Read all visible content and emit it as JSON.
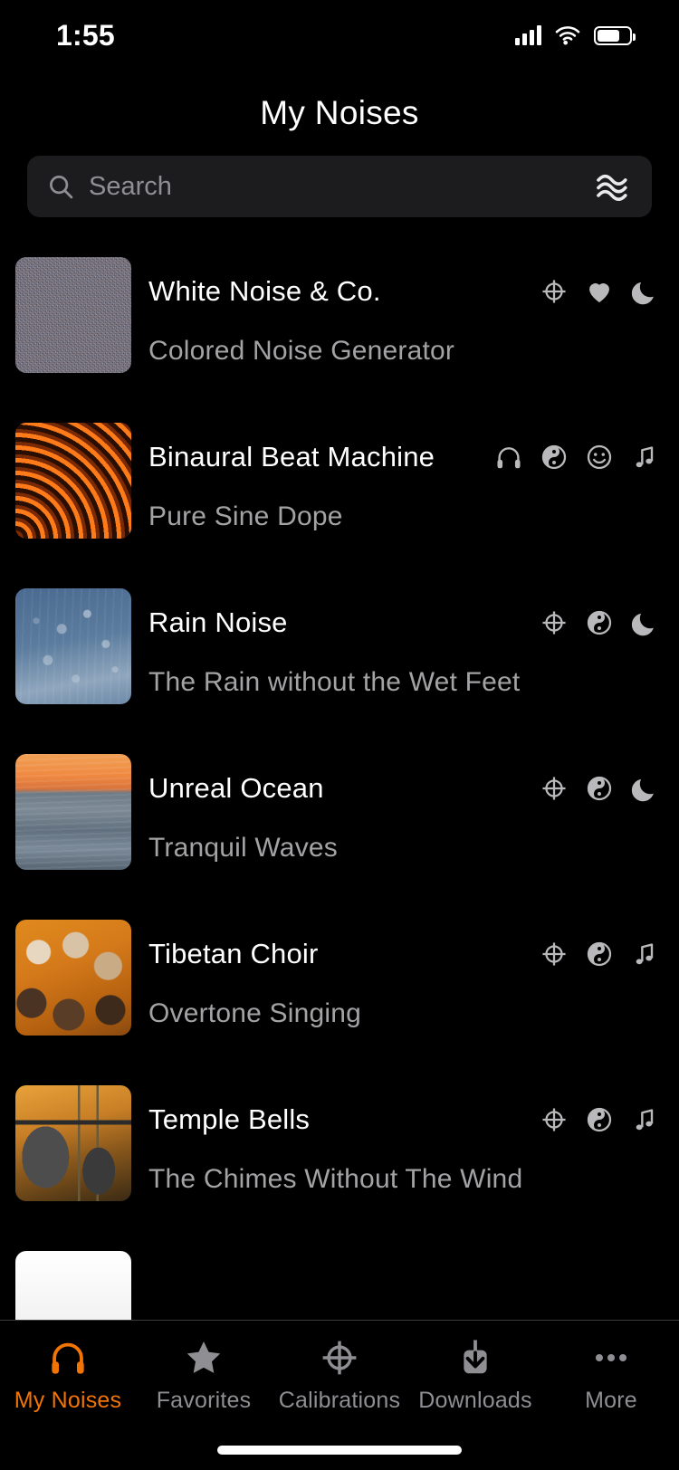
{
  "status_bar": {
    "time": "1:55",
    "cellular_icon": "signal-bars-icon",
    "wifi_icon": "wifi-icon",
    "battery_icon": "battery-icon"
  },
  "header": {
    "title": "My Noises"
  },
  "search": {
    "placeholder": "Search",
    "value": "",
    "search_icon": "search-icon",
    "filter_icon": "waves-icon"
  },
  "colors": {
    "accent": "#f27405",
    "background": "#000000",
    "search_field": "#1c1c1e",
    "primary_text": "#ffffff",
    "secondary_text": "#a3a3a6",
    "inactive_tab": "#8e8e93",
    "row_icon": "#b9b9bc",
    "separator": "#3a3a3c"
  },
  "list": {
    "rows": [
      {
        "title": "White Noise & Co.",
        "subtitle": "Colored Noise Generator",
        "artwork": "static-noise-thumbnail",
        "art_class": "art-noise",
        "icons": [
          "calibration-icon",
          "favorite-icon",
          "sleep-timer-icon"
        ]
      },
      {
        "title": "Binaural Beat Machine",
        "subtitle": "Pure Sine Dope",
        "artwork": "concentric-orange-arcs-thumbnail",
        "art_class": "art-binaural",
        "icons": [
          "headphones-icon",
          "yin-yang-icon",
          "smiley-icon",
          "music-note-icon"
        ]
      },
      {
        "title": "Rain Noise",
        "subtitle": "The Rain without the Wet Feet",
        "artwork": "raindrops-on-window-thumbnail",
        "art_class": "art-rain",
        "icons": [
          "calibration-icon",
          "yin-yang-icon",
          "sleep-timer-icon"
        ]
      },
      {
        "title": "Unreal Ocean",
        "subtitle": "Tranquil Waves",
        "artwork": "ocean-sunset-thumbnail",
        "art_class": "art-ocean",
        "icons": [
          "calibration-icon",
          "yin-yang-icon",
          "sleep-timer-icon"
        ]
      },
      {
        "title": "Tibetan Choir",
        "subtitle": "Overtone Singing",
        "artwork": "monks-in-orange-robes-thumbnail",
        "art_class": "art-tibetan",
        "icons": [
          "calibration-icon",
          "yin-yang-icon",
          "music-note-icon"
        ]
      },
      {
        "title": "Temple Bells",
        "subtitle": "The Chimes Without The Wind",
        "artwork": "temple-bells-thumbnail",
        "art_class": "art-bells",
        "icons": [
          "calibration-icon",
          "yin-yang-icon",
          "music-note-icon"
        ]
      },
      {
        "title": "",
        "subtitle": "",
        "artwork": "white-thumbnail",
        "art_class": "art-white",
        "icons": []
      }
    ]
  },
  "tab_bar": {
    "items": [
      {
        "label": "My Noises",
        "icon": "headphones-icon",
        "active": true
      },
      {
        "label": "Favorites",
        "icon": "star-icon",
        "active": false
      },
      {
        "label": "Calibrations",
        "icon": "calibration-icon",
        "active": false
      },
      {
        "label": "Downloads",
        "icon": "download-icon",
        "active": false
      },
      {
        "label": "More",
        "icon": "ellipsis-icon",
        "active": false
      }
    ]
  }
}
